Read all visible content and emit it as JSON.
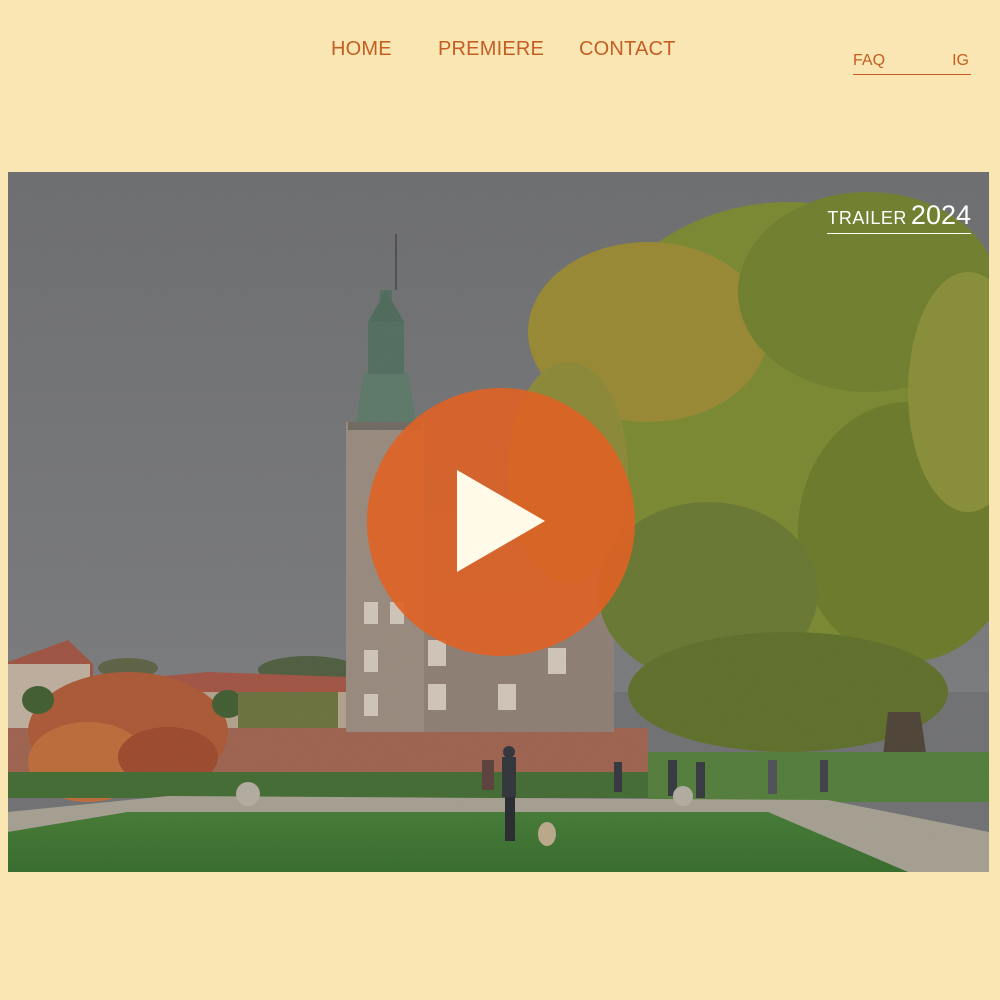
{
  "nav": {
    "items": [
      {
        "label": "HOME"
      },
      {
        "label": "PREMIERE"
      },
      {
        "label": "CONTACT"
      }
    ]
  },
  "aux_links": {
    "faq": "FAQ",
    "ig": "IG"
  },
  "hero": {
    "badge_label": "TRAILER",
    "badge_year": "2024",
    "play_icon": "play-icon"
  },
  "colors": {
    "background": "#fae6b3",
    "accent": "#c45e23",
    "play_button": "#df6225",
    "play_glyph": "#fffbe8",
    "badge_text": "#ffffff"
  }
}
